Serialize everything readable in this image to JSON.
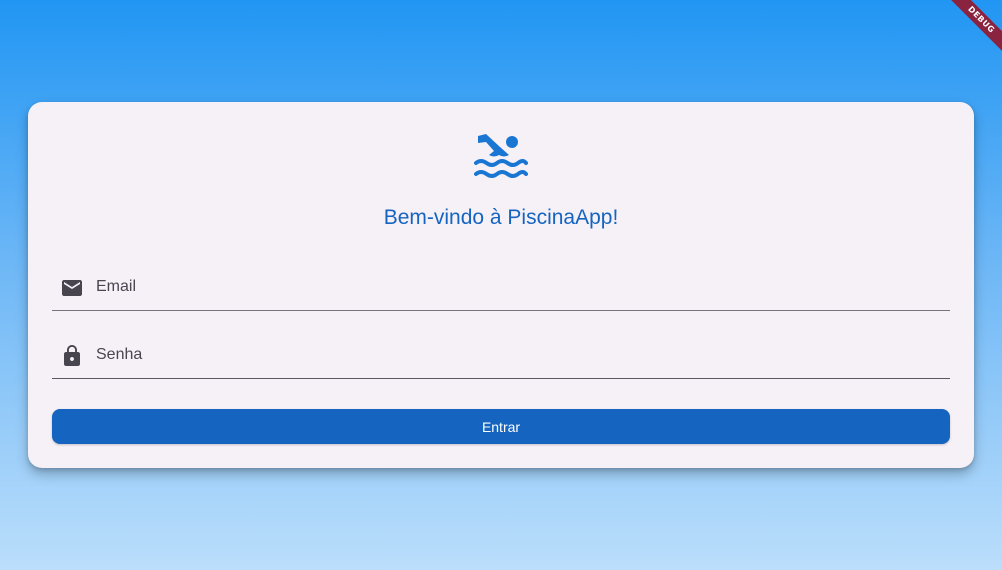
{
  "debug_banner": {
    "label": "DEBUG"
  },
  "login": {
    "logo_icon": "swimming-icon",
    "title": "Bem-vindo à PiscinaApp!",
    "email": {
      "icon": "mail-icon",
      "placeholder": "Email",
      "value": ""
    },
    "senha": {
      "icon": "lock-icon",
      "placeholder": "Senha",
      "value": ""
    },
    "submit_label": "Entrar"
  },
  "colors": {
    "primary": "#1565c0",
    "card_bg": "#f6f0f7",
    "icon": "#49454f",
    "gradient_top": "#2196f3",
    "gradient_bottom": "#bbdefb",
    "debug_banner": "#8a2340"
  }
}
